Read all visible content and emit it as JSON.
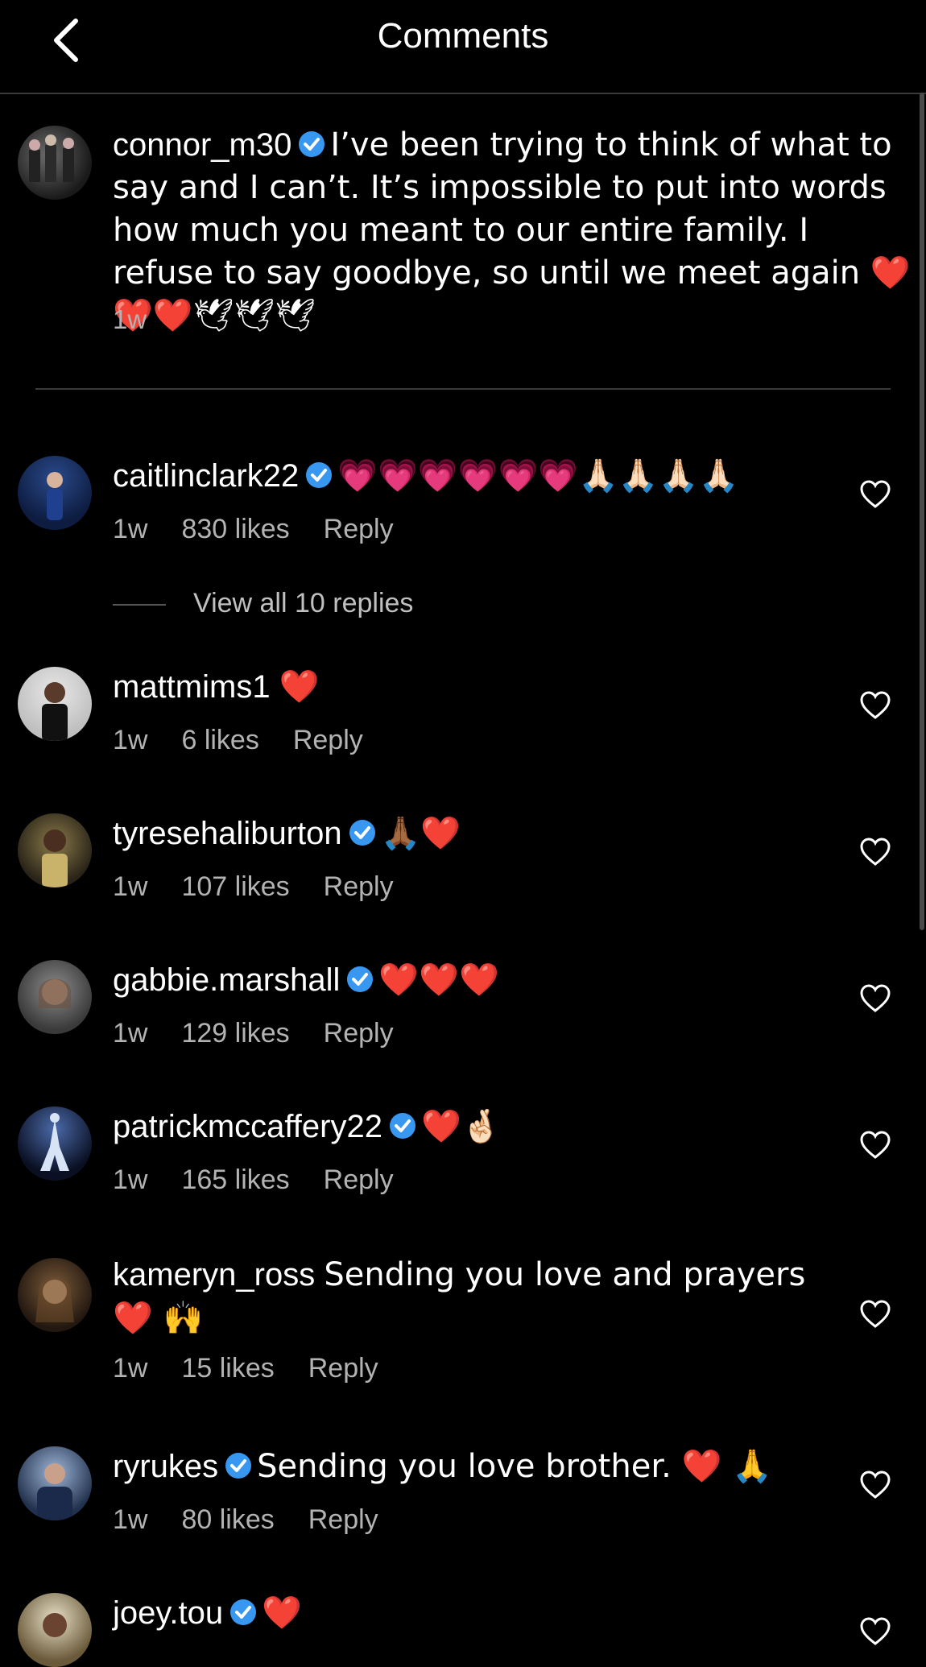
{
  "header": {
    "title": "Comments"
  },
  "caption": {
    "username": "connor_m30",
    "text": "I’ve been trying to think of what to say and I can’t. It’s impossible to put into words how much you meant to our entire family. I refuse to say goodbye, so until we meet again ❤️❤️❤️🕊🕊🕊",
    "time": "1w"
  },
  "comments": [
    {
      "username": "caitlinclark22",
      "text": "💗💗💗💗💗💗🙏🏻🙏🏻🙏🏻🙏🏻",
      "time": "1w",
      "likes": "830 likes",
      "reply": "Reply"
    },
    {
      "username": "mattmims1",
      "text": "❤️",
      "time": "1w",
      "likes": "6 likes",
      "reply": "Reply"
    },
    {
      "username": "tyresehaliburton",
      "text": "🙏🏾❤️",
      "time": "1w",
      "likes": "107 likes",
      "reply": "Reply"
    },
    {
      "username": "gabbie.marshall",
      "text": "❤️❤️❤️",
      "time": "1w",
      "likes": "129 likes",
      "reply": "Reply"
    },
    {
      "username": "patrickmccaffery22",
      "text": "❤️🤞🏻",
      "time": "1w",
      "likes": "165 likes",
      "reply": "Reply"
    },
    {
      "username": "kameryn_ross",
      "text": "Sending you love and prayers❤️ 🙌",
      "time": "1w",
      "likes": "15 likes",
      "reply": "Reply"
    },
    {
      "username": "ryrukes",
      "text": "Sending you love brother. ❤️ 🙏",
      "time": "1w",
      "likes": "80 likes",
      "reply": "Reply"
    },
    {
      "username": "joey.tou",
      "text": "❤️",
      "time": "",
      "likes": "",
      "reply": ""
    }
  ],
  "view_replies": "View all 10 replies",
  "colors": {
    "background": "#000000",
    "text": "#ffffff",
    "muted": "#b3b3b3",
    "verified": "#3897f0"
  },
  "icons": {
    "back": "chevron-left-icon",
    "verified": "verified-badge-icon",
    "like": "heart-outline-icon"
  }
}
